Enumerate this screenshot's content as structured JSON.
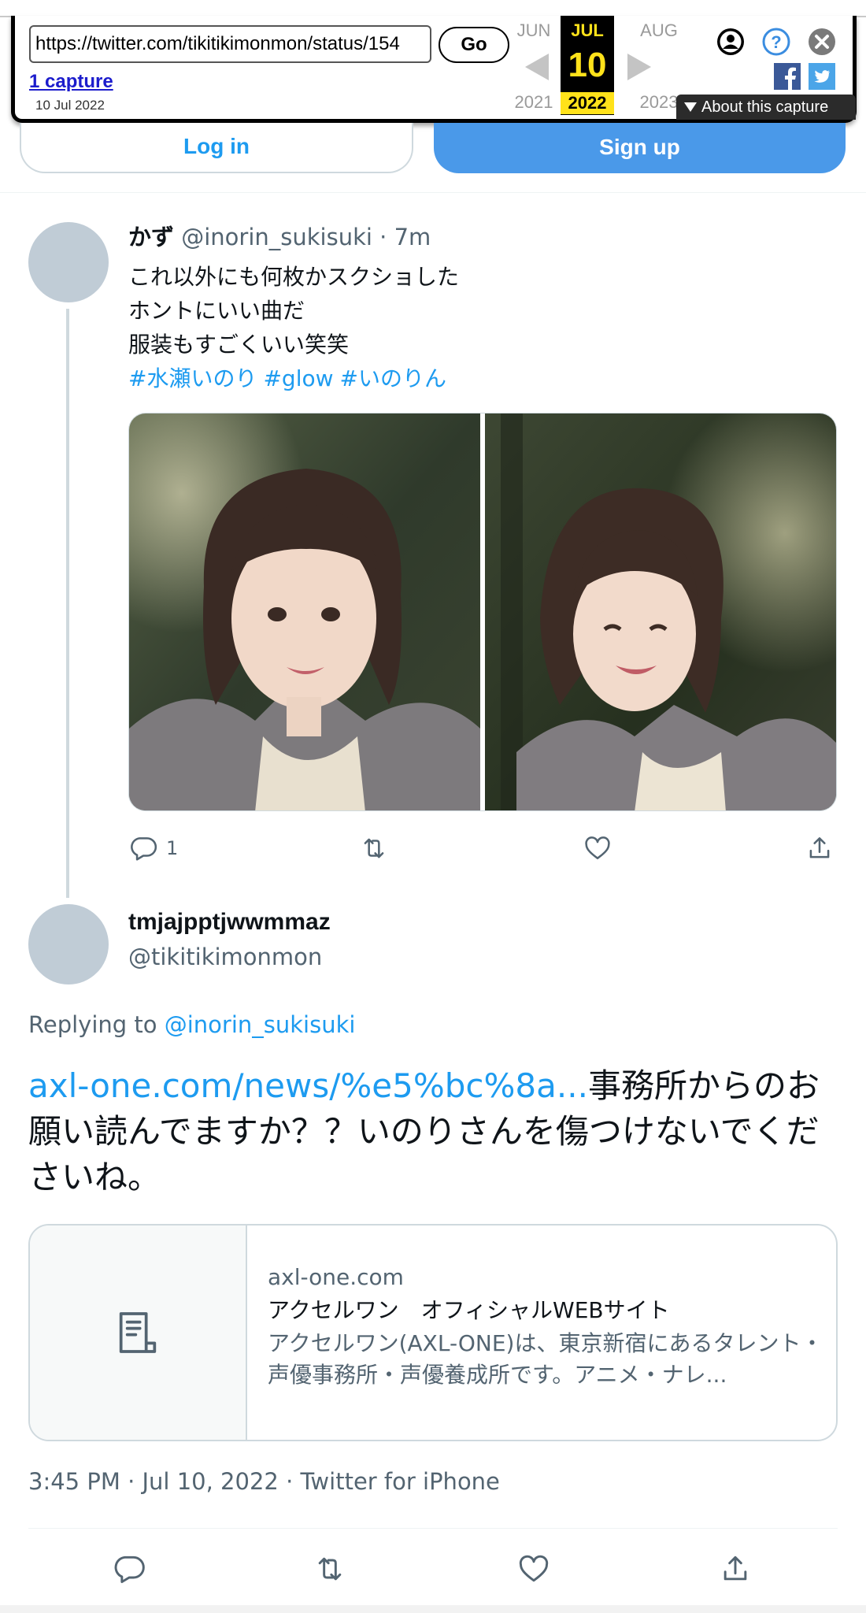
{
  "wayback": {
    "url": "https://twitter.com/tikitikimonmon/status/154",
    "go_label": "Go",
    "captures_label": "1 capture",
    "capture_date": "10 Jul 2022",
    "prev_month": "JUN",
    "current_month": "JUL",
    "next_month": "AUG",
    "prev_year": "2021",
    "current_day": "10",
    "current_year": "2022",
    "next_year": "2023",
    "about_label": "About this capture",
    "colors": {
      "highlight": "#ffe21a",
      "link": "#1c1ccc"
    }
  },
  "auth": {
    "login_label": "Log in",
    "signup_label": "Sign up"
  },
  "parent_tweet": {
    "display_name": "かず",
    "handle_time": "@inorin_sukisuki · 7m",
    "lines": [
      "これ以外にも何枚かスクショした",
      "ホントにいい曲だ",
      "服装もすごくいい笑笑"
    ],
    "hashtags": [
      "#水瀬いのり",
      "#glow",
      "#いのりん"
    ],
    "reply_count": "1"
  },
  "main_tweet": {
    "display_name": "tmjajpptjwwmmaz",
    "handle": "@tikitikimonmon",
    "replying_prefix": "Replying to",
    "replying_to": "@inorin_sukisuki",
    "link_text": "axl-one.com/news/%e5%bc%8a...",
    "body_text": "事務所からのお願い読んでますか？？いのりさんを傷つけないでくださいね。",
    "card": {
      "domain": "axl-one.com",
      "title": "アクセルワン　オフィシャルWEBサイト",
      "description": "アクセルワン(AXL-ONE)は、東京新宿にあるタレント・声優事務所・声優養成所です。アニメ・ナレ..."
    },
    "timestamp": "3:45 PM · Jul 10, 2022 · Twitter for iPhone"
  },
  "colors": {
    "accent": "#1d9bf0",
    "signup": "#4a99e9",
    "secondary_text": "#536471",
    "border": "#cfd9de"
  }
}
